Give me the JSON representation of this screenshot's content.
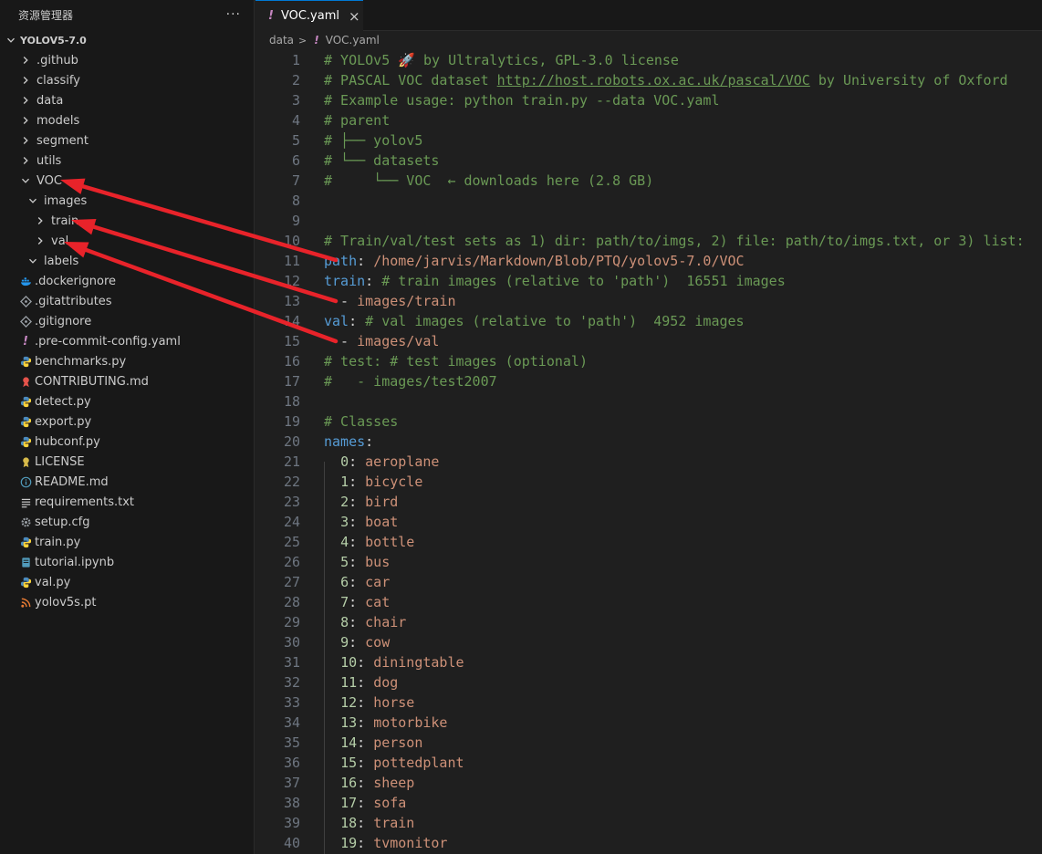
{
  "sidebar": {
    "title": "资源管理器",
    "more": "···",
    "root": "YOLOV5-7.0",
    "items": [
      {
        "label": ".github",
        "depth": 1,
        "kind": "folder",
        "expanded": false,
        "icon": "chevron-right-icon"
      },
      {
        "label": "classify",
        "depth": 1,
        "kind": "folder",
        "expanded": false,
        "icon": "chevron-right-icon"
      },
      {
        "label": "data",
        "depth": 1,
        "kind": "folder",
        "expanded": false,
        "icon": "chevron-right-icon"
      },
      {
        "label": "models",
        "depth": 1,
        "kind": "folder",
        "expanded": false,
        "icon": "chevron-right-icon"
      },
      {
        "label": "segment",
        "depth": 1,
        "kind": "folder",
        "expanded": false,
        "icon": "chevron-right-icon"
      },
      {
        "label": "utils",
        "depth": 1,
        "kind": "folder",
        "expanded": false,
        "icon": "chevron-right-icon"
      },
      {
        "label": "VOC",
        "depth": 1,
        "kind": "folder",
        "expanded": true,
        "icon": "chevron-down-icon"
      },
      {
        "label": "images",
        "depth": 2,
        "kind": "folder",
        "expanded": true,
        "icon": "chevron-down-icon"
      },
      {
        "label": "train",
        "depth": 3,
        "kind": "folder",
        "expanded": false,
        "icon": "chevron-right-icon"
      },
      {
        "label": "val",
        "depth": 3,
        "kind": "folder",
        "expanded": false,
        "icon": "chevron-right-icon"
      },
      {
        "label": "labels",
        "depth": 2,
        "kind": "folder",
        "expanded": true,
        "icon": "chevron-down-icon"
      },
      {
        "label": ".dockerignore",
        "depth": 1,
        "kind": "file",
        "icon": "docker-icon",
        "color": "#2496ed"
      },
      {
        "label": ".gitattributes",
        "depth": 1,
        "kind": "file",
        "icon": "git-icon",
        "color": "#9aa0a6"
      },
      {
        "label": ".gitignore",
        "depth": 1,
        "kind": "file",
        "icon": "git-icon",
        "color": "#9aa0a6"
      },
      {
        "label": ".pre-commit-config.yaml",
        "depth": 1,
        "kind": "file",
        "icon": "yaml-icon",
        "color": "#c586c0"
      },
      {
        "label": "benchmarks.py",
        "depth": 1,
        "kind": "file",
        "icon": "python-icon",
        "color": "#4b8bbe"
      },
      {
        "label": "CONTRIBUTING.md",
        "depth": 1,
        "kind": "file",
        "icon": "contributing-icon",
        "color": "#e5534b"
      },
      {
        "label": "detect.py",
        "depth": 1,
        "kind": "file",
        "icon": "python-icon",
        "color": "#4b8bbe"
      },
      {
        "label": "export.py",
        "depth": 1,
        "kind": "file",
        "icon": "python-icon",
        "color": "#4b8bbe"
      },
      {
        "label": "hubconf.py",
        "depth": 1,
        "kind": "file",
        "icon": "python-icon",
        "color": "#4b8bbe"
      },
      {
        "label": "LICENSE",
        "depth": 1,
        "kind": "file",
        "icon": "license-icon",
        "color": "#d7ba4a"
      },
      {
        "label": "README.md",
        "depth": 1,
        "kind": "file",
        "icon": "info-icon",
        "color": "#519aba"
      },
      {
        "label": "requirements.txt",
        "depth": 1,
        "kind": "file",
        "icon": "text-lines-icon",
        "color": "#cccccc"
      },
      {
        "label": "setup.cfg",
        "depth": 1,
        "kind": "file",
        "icon": "gear-icon",
        "color": "#9aa0a6"
      },
      {
        "label": "train.py",
        "depth": 1,
        "kind": "file",
        "icon": "python-icon",
        "color": "#4b8bbe"
      },
      {
        "label": "tutorial.ipynb",
        "depth": 1,
        "kind": "file",
        "icon": "notebook-icon",
        "color": "#519aba"
      },
      {
        "label": "val.py",
        "depth": 1,
        "kind": "file",
        "icon": "python-icon",
        "color": "#4b8bbe"
      },
      {
        "label": "yolov5s.pt",
        "depth": 1,
        "kind": "file",
        "icon": "rss-icon",
        "color": "#e37933"
      }
    ]
  },
  "tab": {
    "label": "VOC.yaml",
    "bang": "!",
    "close": "×"
  },
  "breadcrumb": {
    "folder": "data",
    "separator": ">",
    "bang": "!",
    "file": "VOC.yaml"
  },
  "editor": {
    "lines": [
      {
        "n": "1",
        "segs": [
          {
            "t": "# YOLOv5 🚀 by Ultralytics, GPL-3.0 license",
            "c": "comment"
          }
        ]
      },
      {
        "n": "2",
        "segs": [
          {
            "t": "# PASCAL VOC dataset ",
            "c": "comment"
          },
          {
            "t": "http://host.robots.ox.ac.uk/pascal/VOC",
            "c": "comment link"
          },
          {
            "t": " by University of Oxford",
            "c": "comment"
          }
        ]
      },
      {
        "n": "3",
        "segs": [
          {
            "t": "# Example usage: python train.py --data VOC.yaml",
            "c": "comment"
          }
        ]
      },
      {
        "n": "4",
        "segs": [
          {
            "t": "# parent",
            "c": "comment"
          }
        ]
      },
      {
        "n": "5",
        "segs": [
          {
            "t": "# ├── yolov5",
            "c": "comment"
          }
        ]
      },
      {
        "n": "6",
        "segs": [
          {
            "t": "# └── datasets",
            "c": "comment"
          }
        ]
      },
      {
        "n": "7",
        "segs": [
          {
            "t": "#     └── VOC  ← downloads here (2.8 GB)",
            "c": "comment"
          }
        ]
      },
      {
        "n": "8",
        "segs": []
      },
      {
        "n": "9",
        "segs": []
      },
      {
        "n": "10",
        "segs": [
          {
            "t": "# Train/val/test sets as 1) dir: path/to/imgs, 2) file: path/to/imgs.txt, or 3) list:",
            "c": "comment"
          }
        ]
      },
      {
        "n": "11",
        "segs": [
          {
            "t": "path",
            "c": "key"
          },
          {
            "t": ": ",
            "c": "punct"
          },
          {
            "t": "/home/jarvis/Markdown/Blob/PTQ/yolov5-7.0/VOC",
            "c": "str"
          }
        ]
      },
      {
        "n": "12",
        "segs": [
          {
            "t": "train",
            "c": "key"
          },
          {
            "t": ": ",
            "c": "punct"
          },
          {
            "t": "# train images (relative to 'path')  16551 images",
            "c": "comment"
          }
        ]
      },
      {
        "n": "13",
        "segs": [
          {
            "t": "  - ",
            "c": "punct"
          },
          {
            "t": "images/train",
            "c": "str"
          }
        ]
      },
      {
        "n": "14",
        "segs": [
          {
            "t": "val",
            "c": "key"
          },
          {
            "t": ": ",
            "c": "punct"
          },
          {
            "t": "# val images (relative to 'path')  4952 images",
            "c": "comment"
          }
        ]
      },
      {
        "n": "15",
        "segs": [
          {
            "t": "  - ",
            "c": "punct"
          },
          {
            "t": "images/val",
            "c": "str"
          }
        ]
      },
      {
        "n": "16",
        "segs": [
          {
            "t": "# test: # test images (optional)",
            "c": "comment"
          }
        ]
      },
      {
        "n": "17",
        "segs": [
          {
            "t": "#   - images/test2007",
            "c": "comment"
          }
        ]
      },
      {
        "n": "18",
        "segs": []
      },
      {
        "n": "19",
        "segs": [
          {
            "t": "# Classes",
            "c": "comment"
          }
        ]
      },
      {
        "n": "20",
        "segs": [
          {
            "t": "names",
            "c": "key"
          },
          {
            "t": ":",
            "c": "punct"
          }
        ]
      },
      {
        "n": "21",
        "segs": [
          {
            "t": "  ",
            "c": "punct"
          },
          {
            "t": "0",
            "c": "num"
          },
          {
            "t": ": ",
            "c": "punct"
          },
          {
            "t": "aeroplane",
            "c": "str"
          }
        ]
      },
      {
        "n": "22",
        "segs": [
          {
            "t": "  ",
            "c": "punct"
          },
          {
            "t": "1",
            "c": "num"
          },
          {
            "t": ": ",
            "c": "punct"
          },
          {
            "t": "bicycle",
            "c": "str"
          }
        ]
      },
      {
        "n": "23",
        "segs": [
          {
            "t": "  ",
            "c": "punct"
          },
          {
            "t": "2",
            "c": "num"
          },
          {
            "t": ": ",
            "c": "punct"
          },
          {
            "t": "bird",
            "c": "str"
          }
        ]
      },
      {
        "n": "24",
        "segs": [
          {
            "t": "  ",
            "c": "punct"
          },
          {
            "t": "3",
            "c": "num"
          },
          {
            "t": ": ",
            "c": "punct"
          },
          {
            "t": "boat",
            "c": "str"
          }
        ]
      },
      {
        "n": "25",
        "segs": [
          {
            "t": "  ",
            "c": "punct"
          },
          {
            "t": "4",
            "c": "num"
          },
          {
            "t": ": ",
            "c": "punct"
          },
          {
            "t": "bottle",
            "c": "str"
          }
        ]
      },
      {
        "n": "26",
        "segs": [
          {
            "t": "  ",
            "c": "punct"
          },
          {
            "t": "5",
            "c": "num"
          },
          {
            "t": ": ",
            "c": "punct"
          },
          {
            "t": "bus",
            "c": "str"
          }
        ]
      },
      {
        "n": "27",
        "segs": [
          {
            "t": "  ",
            "c": "punct"
          },
          {
            "t": "6",
            "c": "num"
          },
          {
            "t": ": ",
            "c": "punct"
          },
          {
            "t": "car",
            "c": "str"
          }
        ]
      },
      {
        "n": "28",
        "segs": [
          {
            "t": "  ",
            "c": "punct"
          },
          {
            "t": "7",
            "c": "num"
          },
          {
            "t": ": ",
            "c": "punct"
          },
          {
            "t": "cat",
            "c": "str"
          }
        ]
      },
      {
        "n": "29",
        "segs": [
          {
            "t": "  ",
            "c": "punct"
          },
          {
            "t": "8",
            "c": "num"
          },
          {
            "t": ": ",
            "c": "punct"
          },
          {
            "t": "chair",
            "c": "str"
          }
        ]
      },
      {
        "n": "30",
        "segs": [
          {
            "t": "  ",
            "c": "punct"
          },
          {
            "t": "9",
            "c": "num"
          },
          {
            "t": ": ",
            "c": "punct"
          },
          {
            "t": "cow",
            "c": "str"
          }
        ]
      },
      {
        "n": "31",
        "segs": [
          {
            "t": "  ",
            "c": "punct"
          },
          {
            "t": "10",
            "c": "num"
          },
          {
            "t": ": ",
            "c": "punct"
          },
          {
            "t": "diningtable",
            "c": "str"
          }
        ]
      },
      {
        "n": "32",
        "segs": [
          {
            "t": "  ",
            "c": "punct"
          },
          {
            "t": "11",
            "c": "num"
          },
          {
            "t": ": ",
            "c": "punct"
          },
          {
            "t": "dog",
            "c": "str"
          }
        ]
      },
      {
        "n": "33",
        "segs": [
          {
            "t": "  ",
            "c": "punct"
          },
          {
            "t": "12",
            "c": "num"
          },
          {
            "t": ": ",
            "c": "punct"
          },
          {
            "t": "horse",
            "c": "str"
          }
        ]
      },
      {
        "n": "34",
        "segs": [
          {
            "t": "  ",
            "c": "punct"
          },
          {
            "t": "13",
            "c": "num"
          },
          {
            "t": ": ",
            "c": "punct"
          },
          {
            "t": "motorbike",
            "c": "str"
          }
        ]
      },
      {
        "n": "35",
        "segs": [
          {
            "t": "  ",
            "c": "punct"
          },
          {
            "t": "14",
            "c": "num"
          },
          {
            "t": ": ",
            "c": "punct"
          },
          {
            "t": "person",
            "c": "str"
          }
        ]
      },
      {
        "n": "36",
        "segs": [
          {
            "t": "  ",
            "c": "punct"
          },
          {
            "t": "15",
            "c": "num"
          },
          {
            "t": ": ",
            "c": "punct"
          },
          {
            "t": "pottedplant",
            "c": "str"
          }
        ]
      },
      {
        "n": "37",
        "segs": [
          {
            "t": "  ",
            "c": "punct"
          },
          {
            "t": "16",
            "c": "num"
          },
          {
            "t": ": ",
            "c": "punct"
          },
          {
            "t": "sheep",
            "c": "str"
          }
        ]
      },
      {
        "n": "38",
        "segs": [
          {
            "t": "  ",
            "c": "punct"
          },
          {
            "t": "17",
            "c": "num"
          },
          {
            "t": ": ",
            "c": "punct"
          },
          {
            "t": "sofa",
            "c": "str"
          }
        ]
      },
      {
        "n": "39",
        "segs": [
          {
            "t": "  ",
            "c": "punct"
          },
          {
            "t": "18",
            "c": "num"
          },
          {
            "t": ": ",
            "c": "punct"
          },
          {
            "t": "train",
            "c": "str"
          }
        ]
      },
      {
        "n": "40",
        "segs": [
          {
            "t": "  ",
            "c": "punct"
          },
          {
            "t": "19",
            "c": "num"
          },
          {
            "t": ": ",
            "c": "punct"
          },
          {
            "t": "tvmonitor",
            "c": "str"
          }
        ]
      }
    ]
  },
  "annotations": {
    "arrow_color": "#e8232a",
    "arrows": [
      {
        "from": "code-line-11",
        "to": "sidebar-item-voc"
      },
      {
        "from": "code-line-13",
        "to": "sidebar-item-train"
      },
      {
        "from": "code-line-15",
        "to": "sidebar-item-val"
      }
    ]
  }
}
